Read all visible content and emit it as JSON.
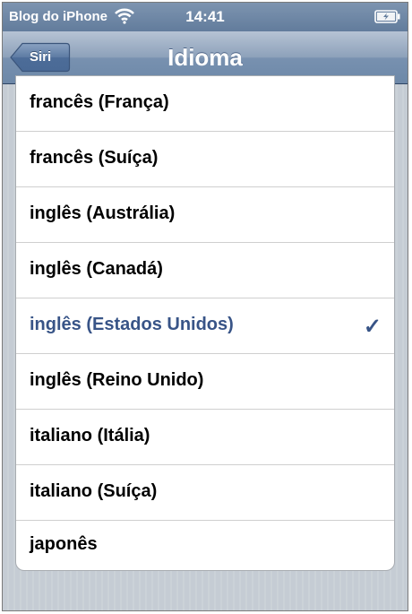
{
  "status_bar": {
    "carrier": "Blog do iPhone",
    "time": "14:41",
    "wifi_icon": "wifi-icon",
    "battery_icon": "battery-charging-icon"
  },
  "nav_bar": {
    "title": "Idioma",
    "back_label": "Siri"
  },
  "languages": [
    {
      "label": "francês (França)",
      "selected": false
    },
    {
      "label": "francês (Suíça)",
      "selected": false
    },
    {
      "label": "inglês (Austrália)",
      "selected": false
    },
    {
      "label": "inglês (Canadá)",
      "selected": false
    },
    {
      "label": "inglês (Estados Unidos)",
      "selected": true,
      "check": "✓"
    },
    {
      "label": "inglês (Reino Unido)",
      "selected": false
    },
    {
      "label": "italiano (Itália)",
      "selected": false
    },
    {
      "label": "italiano (Suíça)",
      "selected": false
    },
    {
      "label": "japonês",
      "selected": false
    }
  ],
  "colors": {
    "selected_text": "#385487",
    "nav_bar": "#6d88a8"
  }
}
